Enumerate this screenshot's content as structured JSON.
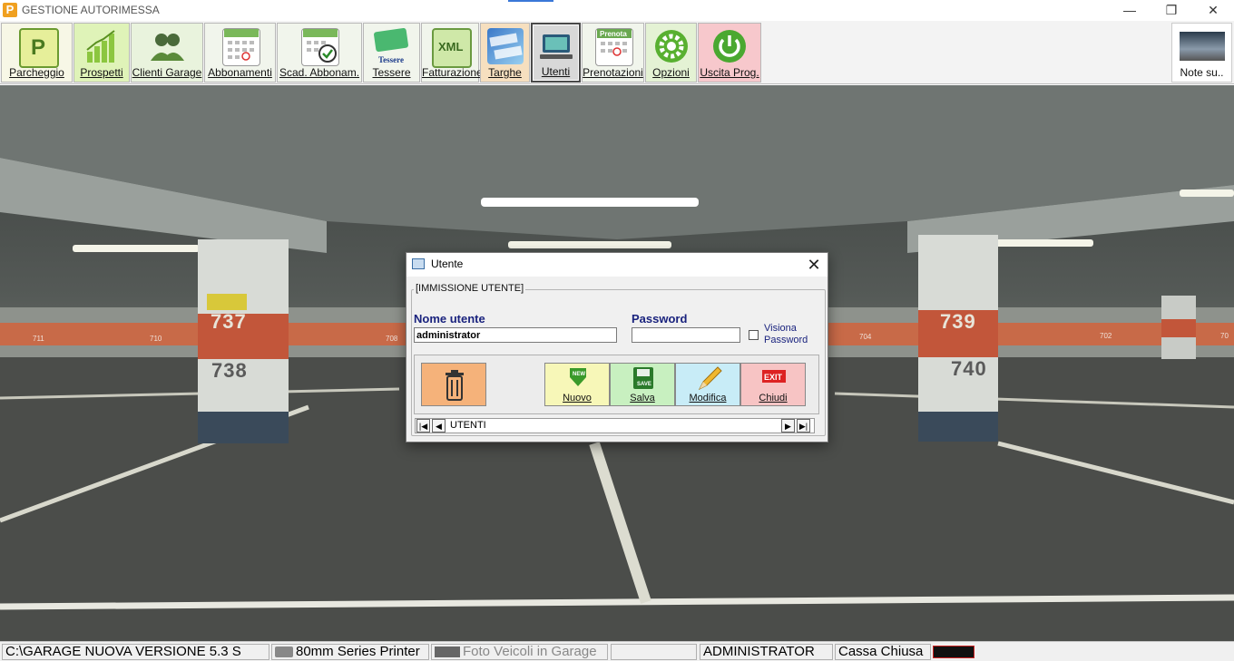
{
  "window": {
    "title": "GESTIONE AUTORIMESSA",
    "app_icon_letter": "P",
    "minimize": "—",
    "maximize": "❐",
    "close": "✕"
  },
  "toolbar": {
    "buttons": [
      {
        "label": "Parcheggio",
        "icon": "parking-sign-icon",
        "color": "#e8f0a8"
      },
      {
        "label": "Prospetti",
        "icon": "bar-chart-icon",
        "color": "#8cc63f"
      },
      {
        "label": "Clienti Garage",
        "icon": "people-icon",
        "color": "#5a8a3a"
      },
      {
        "label": "Abbonamenti",
        "icon": "calendar-icon",
        "color": "#7ab85a"
      },
      {
        "label": "Scad. Abbonam.",
        "icon": "calendar-check-icon",
        "color": "#7ab85a"
      },
      {
        "label": "Tessere",
        "icon": "card-icon",
        "color": "#4ab870",
        "icon_text": "Tessere"
      },
      {
        "label": "Fatturazione",
        "icon": "xml-icon",
        "color": "#cfe8a8",
        "icon_text": "XML"
      },
      {
        "label": "Targhe",
        "icon": "license-plate-icon",
        "color": "#4a88c8"
      },
      {
        "label": "Utenti",
        "icon": "computer-user-icon",
        "color": "#6ac0b8"
      },
      {
        "label": "Prenotazioni",
        "icon": "calendar-booking-icon",
        "color": "#7ab85a",
        "icon_text": "Prenota"
      },
      {
        "label": "Opzioni",
        "icon": "gear-icon",
        "color": "#58b030"
      },
      {
        "label": "Uscita Prog.",
        "icon": "power-icon",
        "color": "#4aa830"
      }
    ],
    "note_button": {
      "label": "Note su..",
      "icon": "garage-photo-icon"
    }
  },
  "dialog": {
    "title": "Utente",
    "group_title": "[IMMISSIONE UTENTE]",
    "username_label": "Nome utente",
    "username_value": "administrator",
    "password_label": "Password",
    "password_value": "",
    "show_password_line1": "Visiona",
    "show_password_line2": "Password",
    "buttons": {
      "delete": {
        "icon": "trash-icon"
      },
      "new": {
        "label": "Nuovo",
        "icon": "new-arrow-icon",
        "icon_text": "NEW"
      },
      "save": {
        "label": "Salva",
        "icon": "save-icon",
        "icon_text": "SAVE"
      },
      "edit": {
        "label": "Modifica",
        "icon": "pencil-icon"
      },
      "close": {
        "label": "Chiudi",
        "icon": "exit-icon",
        "icon_text": "EXIT"
      }
    },
    "nav": {
      "first": "|◀",
      "prev": "◀",
      "record_label": "UTENTI",
      "next": "▶",
      "last": "▶|"
    }
  },
  "scene": {
    "pillar_labels": [
      "737",
      "738",
      "739",
      "740"
    ],
    "floor_numbers": [
      "711",
      "710",
      "708",
      "704",
      "702",
      "70"
    ]
  },
  "statusbar": {
    "path": "C:\\GARAGE NUOVA VERSIONE 5.3 S",
    "printer": "80mm Series Printer",
    "photos": "Foto Veicoli in Garage",
    "empty": "",
    "user": "ADMINISTRATOR",
    "cash": "Cassa Chiusa"
  },
  "colors": {
    "username_label": "#1a237e",
    "delete_btn": "#f5b27a",
    "new_btn": "#f7f7b8",
    "save_btn": "#c8f0c0",
    "edit_btn": "#c8ecf7",
    "close_btn": "#f7c4c4",
    "exit_btn_toolbar": "#f7c8cc",
    "active_toolbar": "#d8d8d8"
  }
}
